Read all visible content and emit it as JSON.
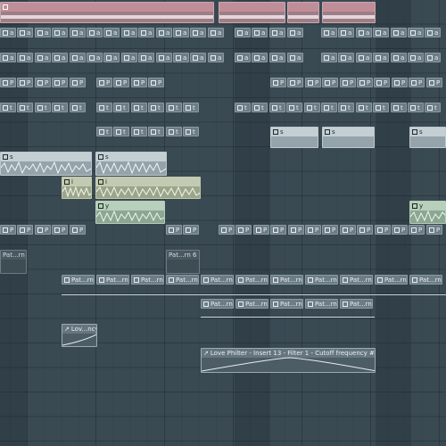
{
  "clips": {
    "pattern_short": "P",
    "pattern_s": "s",
    "pattern_a": "a",
    "pattern_y": "y",
    "pattern_t": "t",
    "pattern_i": "i",
    "pattern_6": "Pat...rn 6",
    "pattern_8": "Pat...rn 8",
    "automation_lov": "Lov...ncy",
    "automation_filter": "Love Philter - Insert 13 - Filter 1 - Cutoff frequency #2"
  },
  "colors": {
    "background": "#3a4a53",
    "pattern_clip": "#63737c",
    "audio_pink": "#c08e98",
    "audio_olive": "#c3cab2",
    "audio_green": "#b7cfbb"
  },
  "icons": {
    "pattern": "pattern-icon",
    "automation": "automation-icon"
  }
}
